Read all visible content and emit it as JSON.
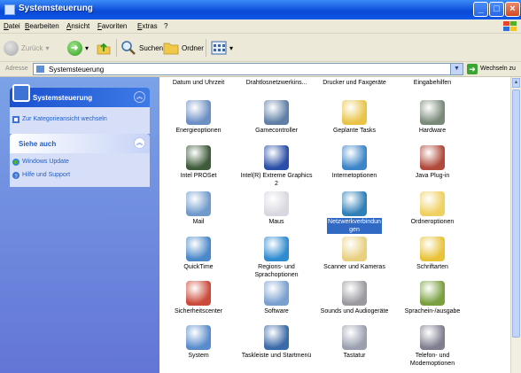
{
  "window": {
    "title": "Systemsteuerung",
    "controls": {
      "minimize": "_",
      "maximize": "□",
      "close": "×"
    }
  },
  "menu": [
    "Datei",
    "Bearbeiten",
    "Ansicht",
    "Favoriten",
    "Extras",
    "?"
  ],
  "toolbar": {
    "back_label": "Zurück",
    "search_label": "Suchen",
    "folders_label": "Ordner"
  },
  "address": {
    "label": "Adresse",
    "value": "Systemsteuerung",
    "go_label": "Wechseln zu"
  },
  "task_pane": {
    "panel1": {
      "title": "Systemsteuerung",
      "link": "Zur Kategorieansicht wechseln"
    },
    "panel2": {
      "title": "Siehe auch",
      "links": [
        "Windows Update",
        "Hilfe und Support"
      ]
    }
  },
  "items_top_row": [
    "Datum und Uhrzeit",
    "Drahtlosnetzwerkins...",
    "Drucker und Faxgeräte",
    "Eingabehilfen"
  ],
  "items": [
    {
      "label": "Energieoptionen",
      "icon": "power-options-icon",
      "color": "#6c8fc4"
    },
    {
      "label": "Gamecontroller",
      "icon": "game-controller-icon",
      "color": "#5f7fa6"
    },
    {
      "label": "Geplante Tasks",
      "icon": "scheduled-tasks-icon",
      "color": "#e9c448"
    },
    {
      "label": "Hardware",
      "icon": "hardware-icon",
      "color": "#7a8a7a"
    },
    {
      "label": "Intel PROSet",
      "icon": "intel-proset-icon",
      "color": "#3e5b3a"
    },
    {
      "label": "Intel(R) Extreme Graphics 2",
      "icon": "intel-graphics-icon",
      "color": "#2a4fa8"
    },
    {
      "label": "Internetoptionen",
      "icon": "internet-options-icon",
      "color": "#3c85c8"
    },
    {
      "label": "Java Plug-in",
      "icon": "java-plugin-icon",
      "color": "#b04a3a"
    },
    {
      "label": "Mail",
      "icon": "mail-icon",
      "color": "#6f9acb"
    },
    {
      "label": "Maus",
      "icon": "mouse-icon",
      "color": "#d8d8e0"
    },
    {
      "label": "Netzwerkverbindungen",
      "icon": "network-connections-icon",
      "color": "#2f7fb8"
    },
    {
      "label": "Ordneroptionen",
      "icon": "folder-options-icon",
      "color": "#f0d060"
    },
    {
      "label": "QuickTime",
      "icon": "quicktime-icon",
      "color": "#4a88c9"
    },
    {
      "label": "Regions- und Sprachoptionen",
      "icon": "regional-options-icon",
      "color": "#2f8bd0"
    },
    {
      "label": "Scanner und Kameras",
      "icon": "scanner-camera-icon",
      "color": "#e8d080"
    },
    {
      "label": "Schriftarten",
      "icon": "fonts-icon",
      "color": "#e8c33a"
    },
    {
      "label": "Sicherheitscenter",
      "icon": "security-center-icon",
      "color": "#cc4a3a"
    },
    {
      "label": "Software",
      "icon": "software-icon",
      "color": "#7aa0d0"
    },
    {
      "label": "Sounds und Audiogeräte",
      "icon": "sounds-icon",
      "color": "#9a9aa0"
    },
    {
      "label": "Sprachein-/ausgabe",
      "icon": "speech-icon",
      "color": "#7aa040"
    },
    {
      "label": "System",
      "icon": "system-icon",
      "color": "#5a8ccc"
    },
    {
      "label": "Taskleiste und Startmenü",
      "icon": "taskbar-icon",
      "color": "#3a6aa8"
    },
    {
      "label": "Tastatur",
      "icon": "keyboard-icon",
      "color": "#9aa0b0"
    },
    {
      "label": "Telefon- und Modemoptionen",
      "icon": "phone-modem-icon",
      "color": "#7f7f90"
    }
  ],
  "selected_item": "Netzwerkverbindungen"
}
